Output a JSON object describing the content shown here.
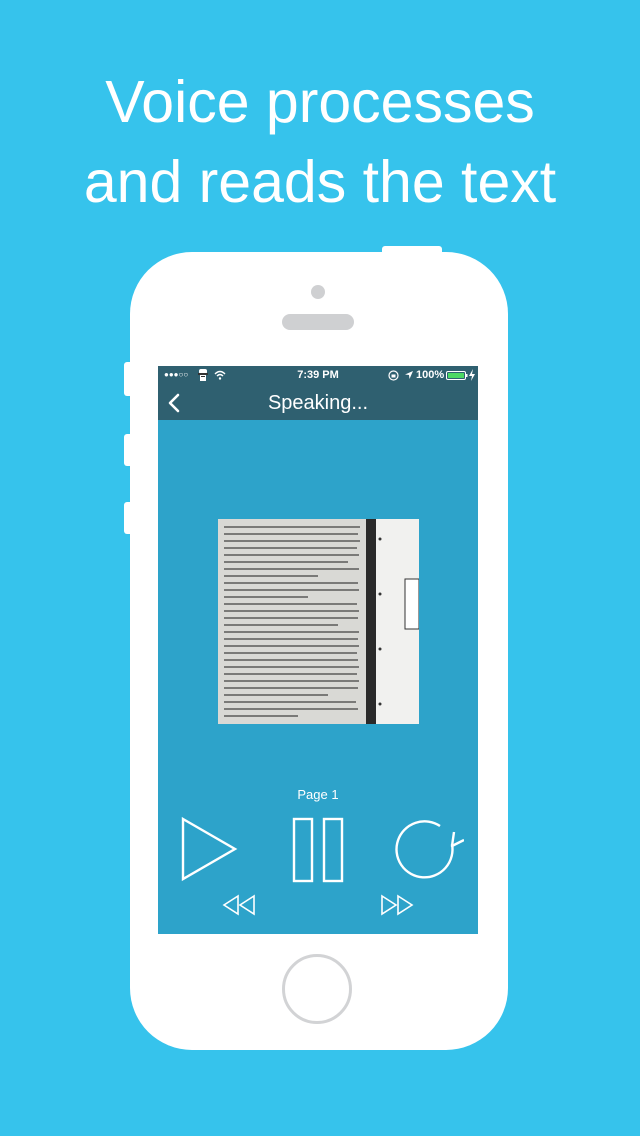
{
  "headline": {
    "line1": "Voice processes",
    "line2": "and reads the text"
  },
  "status_bar": {
    "signal": "●●●○○",
    "time": "7:39 PM",
    "battery": "100%"
  },
  "nav": {
    "title": "Speaking..."
  },
  "player": {
    "page_label": "Page 1"
  },
  "icons": {
    "back": "chevron-left-icon",
    "play": "play-icon",
    "pause": "pause-icon",
    "replay": "replay-icon",
    "rewind": "rewind-icon",
    "fast_forward": "fast-forward-icon"
  },
  "colors": {
    "background": "#36c3ec",
    "nav_bar": "#2f6070",
    "screen": "#2da3ca",
    "phone_body": "#ffffff"
  }
}
